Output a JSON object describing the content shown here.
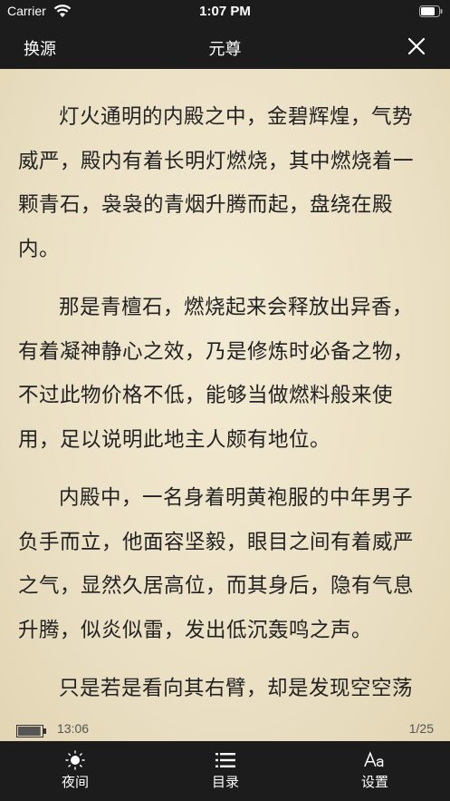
{
  "status_bar": {
    "carrier": "Carrier",
    "time": "1:07 PM"
  },
  "nav": {
    "left_button": "换源",
    "title": "元尊"
  },
  "content": {
    "paragraphs": [
      "灯火通明的内殿之中，金碧辉煌，气势威严，殿内有着长明灯燃烧，其中燃烧着一颗青石，袅袅的青烟升腾而起，盘绕在殿内。",
      "那是青檀石，燃烧起来会释放出异香，有着凝神静心之效，乃是修炼时必备之物，不过此物价格不低，能够当做燃料般来使用，足以说明此地主人颇有地位。",
      "内殿中，一名身着明黄袍服的中年男子负手而立，他面容坚毅，眼目之间有着威严之气，显然久居高位，而其身后，隐有气息升腾，似炎似雷，发出低沉轰鸣之声。",
      "只是若是看向其右臂，却是发现空空荡"
    ]
  },
  "reader_footer": {
    "time": "13:06",
    "page": "1/25",
    "battery_level": 0.95
  },
  "tabbar": {
    "items": [
      {
        "label": "夜间",
        "icon": "sun-icon"
      },
      {
        "label": "目录",
        "icon": "list-icon"
      },
      {
        "label": "设置",
        "icon": "font-settings-icon"
      }
    ]
  }
}
